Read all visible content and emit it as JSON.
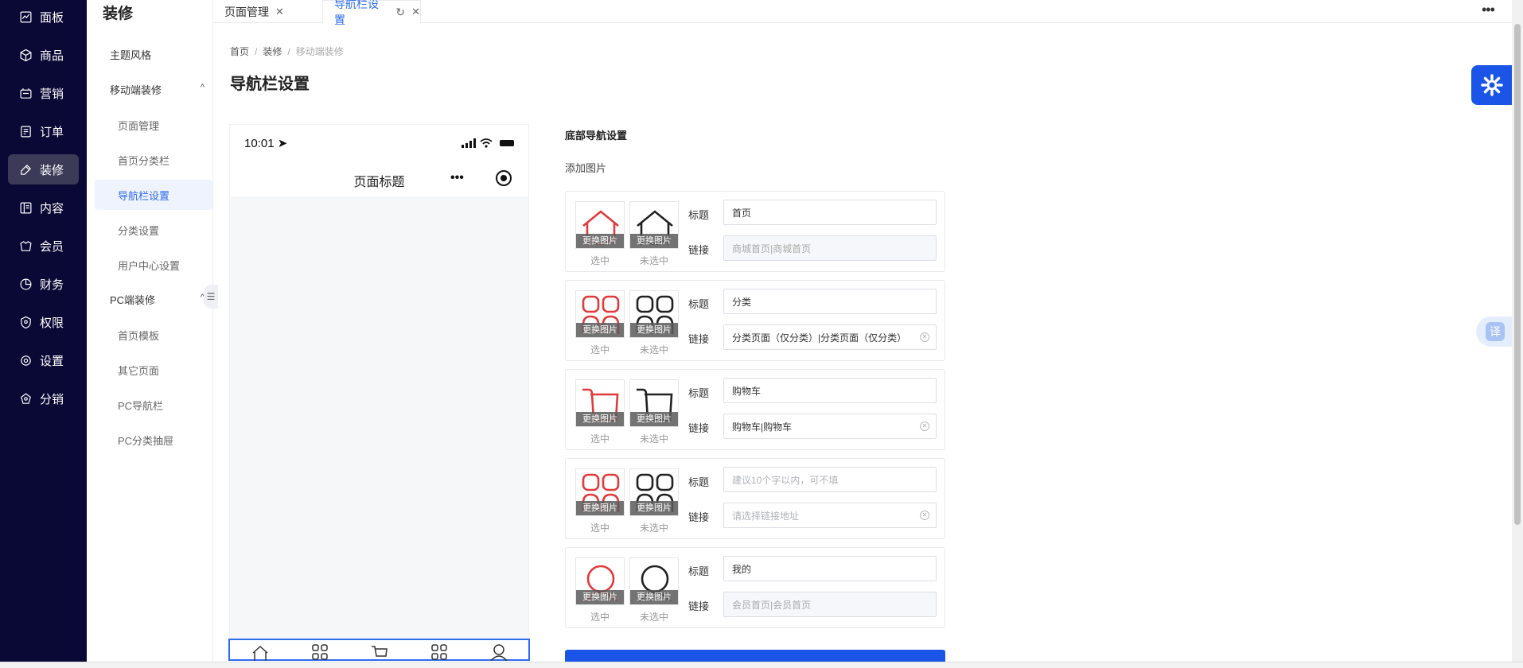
{
  "sidebar": {
    "items": [
      {
        "label": "面板",
        "icon": "chart-icon",
        "active": false
      },
      {
        "label": "商品",
        "icon": "box-icon",
        "active": false
      },
      {
        "label": "营销",
        "icon": "marketing-icon",
        "active": false
      },
      {
        "label": "订单",
        "icon": "order-icon",
        "active": false
      },
      {
        "label": "装修",
        "icon": "brush-icon",
        "active": true
      },
      {
        "label": "内容",
        "icon": "content-icon",
        "active": false
      },
      {
        "label": "会员",
        "icon": "member-icon",
        "active": false
      },
      {
        "label": "财务",
        "icon": "finance-icon",
        "active": false
      },
      {
        "label": "权限",
        "icon": "shield-icon",
        "active": false
      },
      {
        "label": "设置",
        "icon": "settings-icon",
        "active": false
      },
      {
        "label": "分销",
        "icon": "distribution-icon",
        "active": false
      }
    ]
  },
  "submenu": {
    "title": "装修",
    "items": [
      {
        "label": "主题风格"
      },
      {
        "label": "移动端装修",
        "caret": "^"
      },
      {
        "label": "页面管理"
      },
      {
        "label": "首页分类栏"
      },
      {
        "label": "导航栏设置"
      },
      {
        "label": "分类设置"
      },
      {
        "label": "用户中心设置"
      },
      {
        "label": "PC端装修",
        "caret": "^"
      },
      {
        "label": "首页模板"
      },
      {
        "label": "其它页面"
      },
      {
        "label": "PC导航栏"
      },
      {
        "label": "PC分类抽屉"
      }
    ]
  },
  "tabs": [
    {
      "label": "页面管理"
    },
    {
      "label": "导航栏设置"
    }
  ],
  "breadcrumb": [
    "首页",
    "装修",
    "移动端装修"
  ],
  "page_title": "导航栏设置",
  "phone": {
    "time": "10:01",
    "title": "页面标题"
  },
  "section": {
    "title": "底部导航设置",
    "add_label": "添加图片"
  },
  "labels": {
    "change_image": "更换图片",
    "selected": "选中",
    "unselected": "未选中",
    "title_field": "标题",
    "link_field": "链接"
  },
  "nav_items": [
    {
      "icon": "home-icon",
      "title": "首页",
      "title_placeholder": "",
      "link": "商城首页|商城首页",
      "link_disabled": true,
      "link_placeholder": false
    },
    {
      "icon": "category-icon",
      "title": "分类",
      "title_placeholder": "",
      "link": "分类页面（仅分类）|分类页面（仅分类）",
      "link_disabled": false,
      "link_placeholder": false
    },
    {
      "icon": "cart-icon",
      "title": "购物车",
      "title_placeholder": "",
      "link": "购物车|购物车",
      "link_disabled": false,
      "link_placeholder": false
    },
    {
      "icon": "category-icon",
      "title": "",
      "title_placeholder": "建议10个字以内，可不填",
      "link": "请选择链接地址",
      "link_disabled": false,
      "link_placeholder": true
    },
    {
      "icon": "user-icon",
      "title": "我的",
      "title_placeholder": "",
      "link": "会员首页|会员首页",
      "link_disabled": true,
      "link_placeholder": false
    }
  ],
  "floating": {
    "translate_label": "译"
  },
  "colors": {
    "sidebar_bg": "#0a0835",
    "accent": "#1b55e8",
    "selected_icon": "#e03a3a",
    "unselected_icon": "#222222"
  }
}
